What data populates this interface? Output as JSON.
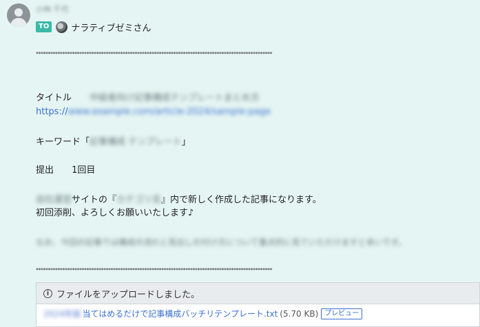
{
  "header": {
    "sender_name": "小林 千代",
    "to_badge": "TO",
    "recipient": "ナラティブゼミさん"
  },
  "message": {
    "separator": "**************************************************************************************************",
    "title_label": "タイトル",
    "title_blurred": "中級者向け記事構成テンプレートまとめ方",
    "link_prefix": "https://",
    "link_blurred": "www.example.com/article-2024/sample-page",
    "keyword_open": "キーワード「",
    "keyword_blurred": "記事構成 テンプレート",
    "keyword_close": "」",
    "submit_label": "提出",
    "submit_value": "1回目",
    "para1_blurred": "自社運営",
    "para1_text_a": "サイトの『",
    "para1_blurred2": "カテゴリ名",
    "para1_text_b": "』内で新しく作成した記事になります。",
    "para2": "初回添削、よろしくお願いいたします♪",
    "para3_blurred": "なお、今回の記事では構成の流れと見出しの付け方について重点的に見ていただけますと幸いです。"
  },
  "attachment": {
    "notice": "ファイルをアップロードしました。",
    "file_prefix_blurred": "2024年版",
    "file_name": "当てはめるだけで記事構成バッチリテンプレート.txt",
    "file_size": "(5.70 KB)",
    "preview_label": "プレビュー"
  },
  "colors": {
    "background": "#e5f5f3",
    "to_badge": "#39b9a6",
    "link": "#3a6fd1"
  }
}
